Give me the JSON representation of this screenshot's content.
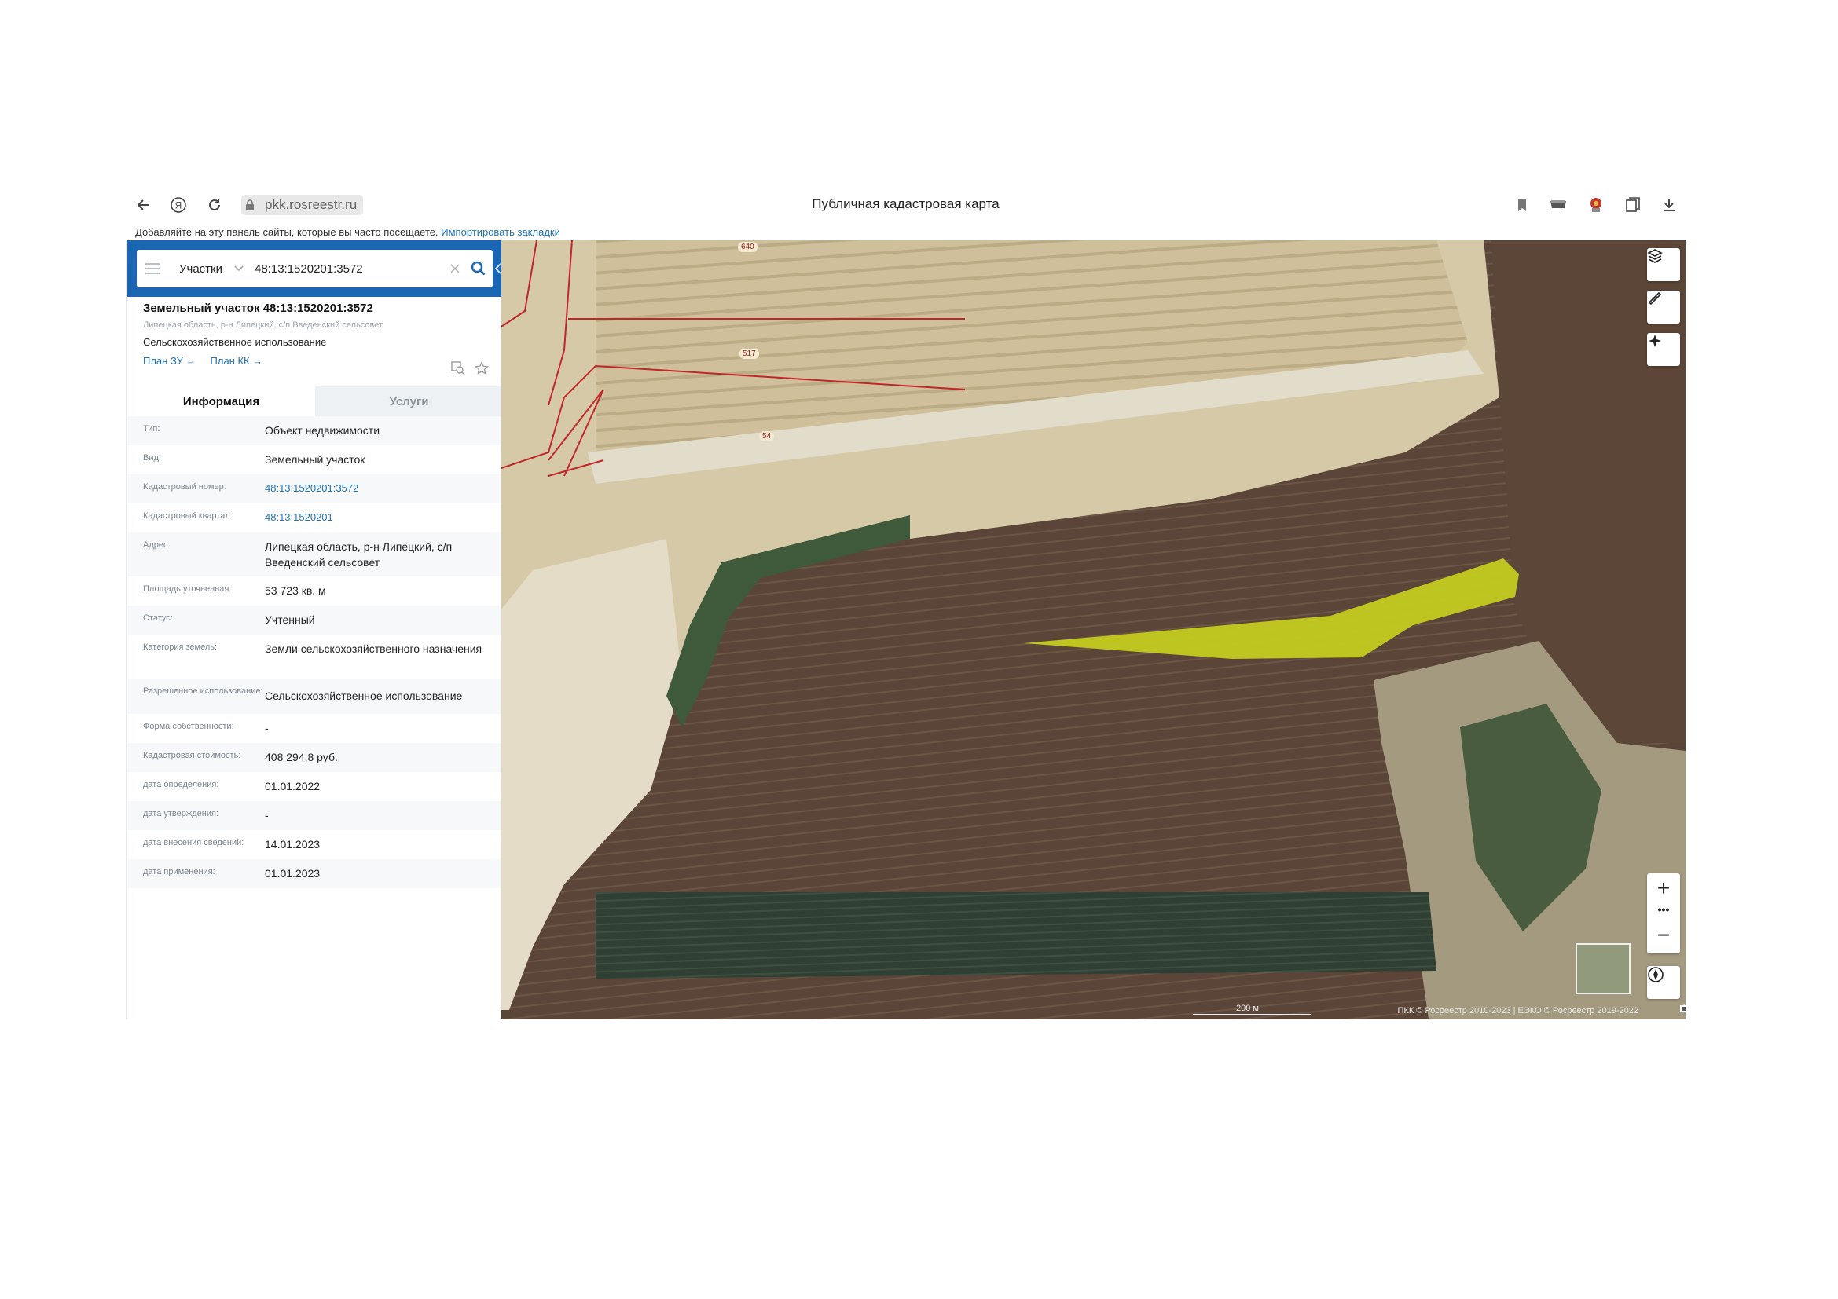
{
  "browser": {
    "url": "pkk.rosreestr.ru",
    "page_title": "Публичная кадастровая карта",
    "bookmarks_hint": "Добавляйте на эту панель сайты, которые вы часто посещаете.",
    "bookmarks_import": "Импортировать закладки",
    "yandex_glyph": "Я"
  },
  "search": {
    "type": "Участки",
    "value": "48:13:1520201:3572"
  },
  "object": {
    "title": "Земельный участок 48:13:1520201:3572",
    "address": "Липецкая область, р-н Липецкий, с/п Введенский сельсовет",
    "usage": "Сельскохозяйственное использование",
    "links": [
      "План ЗУ →",
      "План КК →"
    ]
  },
  "tabs": [
    {
      "label": "Информация",
      "active": true
    },
    {
      "label": "Услуги",
      "active": false
    }
  ],
  "properties": [
    {
      "label": "Тип:",
      "value": "Объект недвижимости"
    },
    {
      "label": "Вид:",
      "value": "Земельный участок"
    },
    {
      "label": "Кадастровый номер:",
      "value": "48:13:1520201:3572",
      "link": true
    },
    {
      "label": "Кадастровый квартал:",
      "value": "48:13:1520201",
      "link": true
    },
    {
      "label": "Адрес:",
      "value": "Липецкая область, р-н Липецкий, с/п Введенский сельсовет"
    },
    {
      "label": "Площадь уточненная:",
      "value": "53 723 кв. м"
    },
    {
      "label": "Статус:",
      "value": "Учтенный"
    },
    {
      "label": "Категория земель:",
      "value": "Земли сельскохозяйственного назначения"
    },
    {
      "label": "Разрешенное использование:",
      "value": "Сельскохозяйственное использование"
    },
    {
      "label": "Форма собственности:",
      "value": "-"
    },
    {
      "label": "Кадастровая стоимость:",
      "value": "408 294,8 руб."
    },
    {
      "label": "дата определения:",
      "value": "01.01.2022"
    },
    {
      "label": "дата утверждения:",
      "value": "-"
    },
    {
      "label": "дата внесения сведений:",
      "value": "14.01.2023"
    },
    {
      "label": "дата применения:",
      "value": "01.01.2023"
    }
  ],
  "map": {
    "road_labels": [
      "640",
      "517",
      "54"
    ],
    "scale": "200 м",
    "copyright": "ПКК © Росреестр 2010-2023 | ЕЭКО © Росреестр 2019-2022",
    "zoom_in": "+",
    "zoom_dots": "•••",
    "zoom_out": "−",
    "colors": {
      "parcel_fill": "#c9d21e",
      "boundary": "#c0262a",
      "sand": "#d6c9a8",
      "field": "#5a4538",
      "vegetation": "#3e5a3a"
    }
  }
}
